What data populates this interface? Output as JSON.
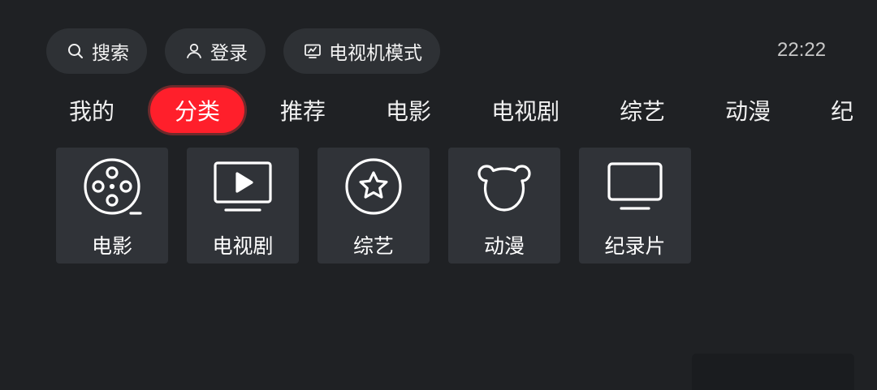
{
  "topbar": {
    "search": {
      "label": "搜索",
      "icon": "search-icon"
    },
    "login": {
      "label": "登录",
      "icon": "user-icon"
    },
    "tv_mode": {
      "label": "电视机模式",
      "icon": "tv-icon"
    }
  },
  "clock": "22:22",
  "tabs": [
    {
      "label": "我的"
    },
    {
      "label": "分类",
      "active": true
    },
    {
      "label": "推荐"
    },
    {
      "label": "电影"
    },
    {
      "label": "电视剧"
    },
    {
      "label": "综艺"
    },
    {
      "label": "动漫"
    },
    {
      "label": "纪"
    }
  ],
  "categories": [
    {
      "label": "电影",
      "icon": "film-reel-icon"
    },
    {
      "label": "电视剧",
      "icon": "play-screen-icon"
    },
    {
      "label": "综艺",
      "icon": "star-circle-icon"
    },
    {
      "label": "动漫",
      "icon": "bear-icon"
    },
    {
      "label": "纪录片",
      "icon": "monitor-icon"
    }
  ],
  "colors": {
    "background": "#1f2124",
    "accent": "#ff1f2b",
    "pill": "#2e3135",
    "tile": "#303338"
  }
}
